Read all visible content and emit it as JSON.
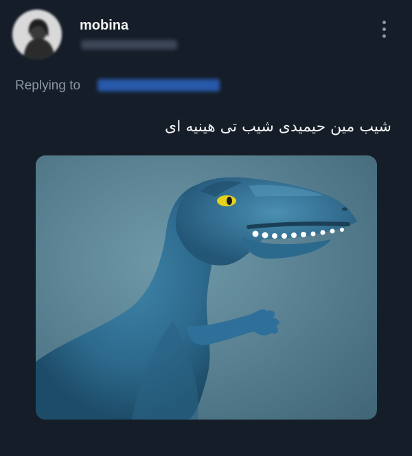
{
  "tweet": {
    "author_name": "mobina",
    "replying_label": "Replying to",
    "text": "شیب مین حیمیدی شیب تی هینیه ای"
  },
  "icons": {
    "more": "more-options-icon"
  }
}
